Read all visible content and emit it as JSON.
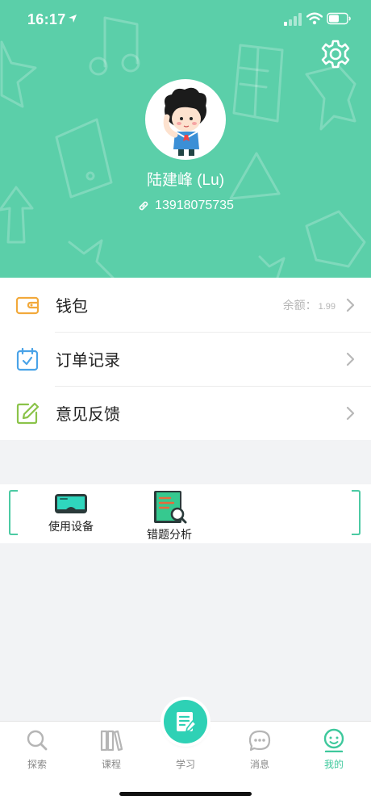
{
  "status_bar": {
    "time": "16:17",
    "icons": [
      "location-arrow-icon",
      "signal-icon",
      "wifi-icon",
      "battery-icon"
    ]
  },
  "profile": {
    "name": "陆建峰 (Lu)",
    "phone": "13918075735",
    "header_color": "#5bcfa9"
  },
  "menu": {
    "items": [
      {
        "label": "钱包",
        "extra_label": "余额：",
        "extra_value": "1.99",
        "icon": "wallet-icon"
      },
      {
        "label": "订单记录",
        "icon": "calendar-check-icon"
      },
      {
        "label": "意见反馈",
        "icon": "edit-icon"
      }
    ]
  },
  "tools": {
    "items": [
      {
        "label": "使用设备",
        "icon": "vr-headset-icon"
      },
      {
        "label": "错题分析",
        "icon": "error-analysis-icon"
      }
    ]
  },
  "tabbar": {
    "tabs": [
      {
        "label": "探索",
        "icon": "search-icon"
      },
      {
        "label": "课程",
        "icon": "books-icon"
      },
      {
        "label": "学习",
        "icon": "study-notebook-icon"
      },
      {
        "label": "消息",
        "icon": "chat-bubble-icon"
      },
      {
        "label": "我的",
        "icon": "profile-icon",
        "active": true
      }
    ],
    "active_color": "#3ec89c"
  }
}
